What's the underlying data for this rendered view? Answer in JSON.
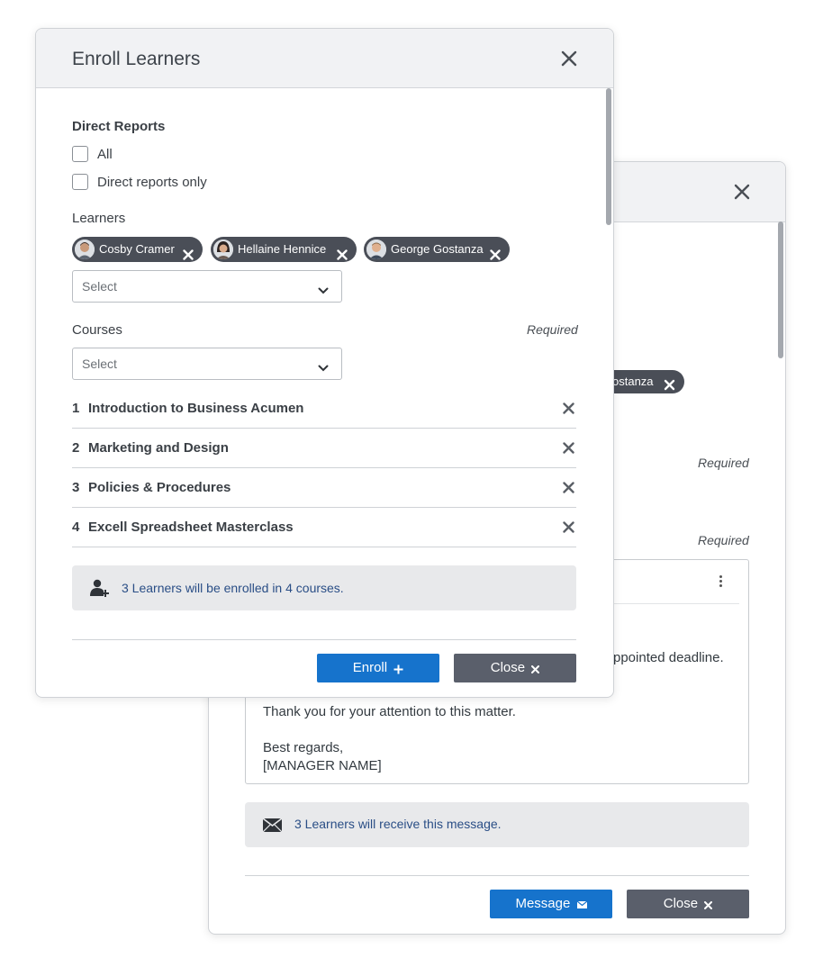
{
  "back_modal": {
    "chip_fragment": "ostanza",
    "required_labels": [
      "Required",
      "Required"
    ],
    "message_lines": {
      "partial": "ppointed deadline.",
      "thanks": "Thank you for your attention to this matter.",
      "closing": "Best regards,",
      "signature": "[MANAGER NAME]"
    },
    "info_text": "3 Learners will receive this message.",
    "message_button": "Message",
    "close_button": "Close"
  },
  "front_modal": {
    "title": "Enroll Learners",
    "direct_reports": {
      "heading": "Direct Reports",
      "options": [
        "All",
        "Direct reports only"
      ]
    },
    "learners": {
      "label": "Learners",
      "chips": [
        "Cosby Cramer",
        "Hellaine Hennice",
        "George Gostanza"
      ],
      "select_placeholder": "Select"
    },
    "courses": {
      "label": "Courses",
      "required": "Required",
      "select_placeholder": "Select",
      "items": [
        {
          "num": "1",
          "title": "Introduction to Business Acumen"
        },
        {
          "num": "2",
          "title": "Marketing and Design"
        },
        {
          "num": "3",
          "title": "Policies & Procedures"
        },
        {
          "num": "4",
          "title": "Excell Spreadsheet Masterclass"
        }
      ]
    },
    "info_text": "3 Learners will be enrolled in 4 courses.",
    "enroll_button": "Enroll",
    "close_button": "Close"
  },
  "icons": {
    "close": "close-icon",
    "chevron": "chevron-down-icon",
    "add_user": "add-user-icon",
    "envelope": "envelope-icon",
    "kebab": "more-vertical-icon"
  },
  "colors": {
    "primary": "#1673cc",
    "dark_button": "#5a5f6b",
    "chip": "#4a4e57",
    "info_text": "#2a4e86",
    "info_bg": "#e8e9eb"
  }
}
